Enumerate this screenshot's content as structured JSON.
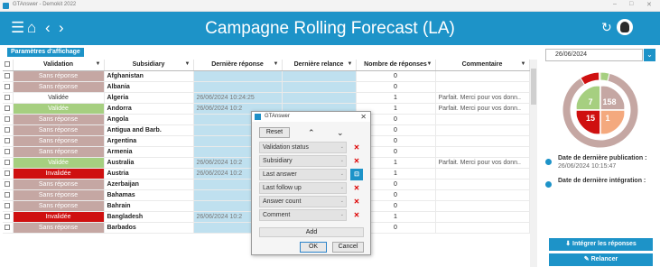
{
  "window": {
    "title": "GTAnswer - Demokit 2022",
    "controls": [
      "–",
      "□",
      "✕"
    ]
  },
  "header": {
    "menu_icon": "☰",
    "home_icon": "⌂",
    "back_icon": "‹",
    "forward_icon": "›",
    "title": "Campagne Rolling Forecast (LA)",
    "refresh_icon": "↻",
    "color": "#1d93c8"
  },
  "params_button": "Paramètres d'affichage",
  "grid": {
    "columns": [
      {
        "label": "Validation"
      },
      {
        "label": "Subsidiary"
      },
      {
        "label": "Dernière réponse"
      },
      {
        "label": "Dernière relance"
      },
      {
        "label": "Nombre de réponses"
      },
      {
        "label": "Commentaire"
      }
    ],
    "rows": [
      {
        "validation": "Sans réponse",
        "status": "sans",
        "subsidiary": "Afghanistan",
        "reponse": "",
        "count": "0",
        "comment": ""
      },
      {
        "validation": "Sans réponse",
        "status": "sans",
        "subsidiary": "Albania",
        "reponse": "",
        "count": "0",
        "comment": ""
      },
      {
        "validation": "Validée",
        "status": "valid",
        "subsidiary": "Algeria",
        "reponse": "26/06/2024 10:24:25",
        "count": "1",
        "comment": "Parfait. Merci pour vos donn.."
      },
      {
        "validation": "Validée",
        "status": "valid2",
        "subsidiary": "Andorra",
        "reponse": "26/06/2024 10:2",
        "count": "1",
        "comment": "Parfait. Merci pour vos donn.."
      },
      {
        "validation": "Sans réponse",
        "status": "sans",
        "subsidiary": "Angola",
        "reponse": "",
        "count": "0",
        "comment": ""
      },
      {
        "validation": "Sans réponse",
        "status": "sans",
        "subsidiary": "Antigua and Barb.",
        "reponse": "",
        "count": "0",
        "comment": ""
      },
      {
        "validation": "Sans réponse",
        "status": "sans",
        "subsidiary": "Argentina",
        "reponse": "",
        "count": "0",
        "comment": ""
      },
      {
        "validation": "Sans réponse",
        "status": "sans",
        "subsidiary": "Armenia",
        "reponse": "",
        "count": "0",
        "comment": ""
      },
      {
        "validation": "Validée",
        "status": "valid2",
        "subsidiary": "Australia",
        "reponse": "26/06/2024 10:2",
        "count": "1",
        "comment": "Parfait. Merci pour vos donn.."
      },
      {
        "validation": "Invalidée",
        "status": "inval",
        "subsidiary": "Austria",
        "reponse": "26/06/2024 10:2",
        "count": "1",
        "comment": ""
      },
      {
        "validation": "Sans réponse",
        "status": "sans",
        "subsidiary": "Azerbaijan",
        "reponse": "",
        "count": "0",
        "comment": ""
      },
      {
        "validation": "Sans réponse",
        "status": "sans",
        "subsidiary": "Bahamas",
        "reponse": "",
        "count": "0",
        "comment": ""
      },
      {
        "validation": "Sans réponse",
        "status": "sans",
        "subsidiary": "Bahrain",
        "reponse": "",
        "count": "0",
        "comment": ""
      },
      {
        "validation": "Invalidée",
        "status": "inval",
        "subsidiary": "Bangladesh",
        "reponse": "26/06/2024 10:2",
        "count": "1",
        "comment": ""
      },
      {
        "validation": "Sans réponse",
        "status": "sans",
        "subsidiary": "Barbados",
        "reponse": "",
        "count": "0",
        "comment": ""
      }
    ]
  },
  "right_panel": {
    "date": "26/06/2024",
    "donut": {
      "segments": [
        {
          "label": "7",
          "value": 7,
          "color": "#a6cf80"
        },
        {
          "label": "158",
          "value": 158,
          "color": "#c5a7a3"
        },
        {
          "label": "15",
          "value": 15,
          "color": "#cf1010"
        },
        {
          "label": "1",
          "value": 1,
          "color": "#f4a97e"
        }
      ]
    },
    "pub_label": "Date de dernière publication :",
    "pub_value": "26/06/2024 10:15:47",
    "integ_label": "Date de dernière intégration :",
    "integrate_button": "Intégrer les réponses",
    "relaunch_button": "Relancer"
  },
  "dialog": {
    "title": "GTAnswer",
    "close_icon": "✕",
    "reset": "Reset",
    "up_icon": "⌃",
    "down_icon": "⌄",
    "rows": [
      "Validation status",
      "Subsidiary",
      "Last answer",
      "Last follow up",
      "Answer count",
      "Comment"
    ],
    "add": "Add",
    "ok": "OK",
    "cancel": "Cancel"
  }
}
